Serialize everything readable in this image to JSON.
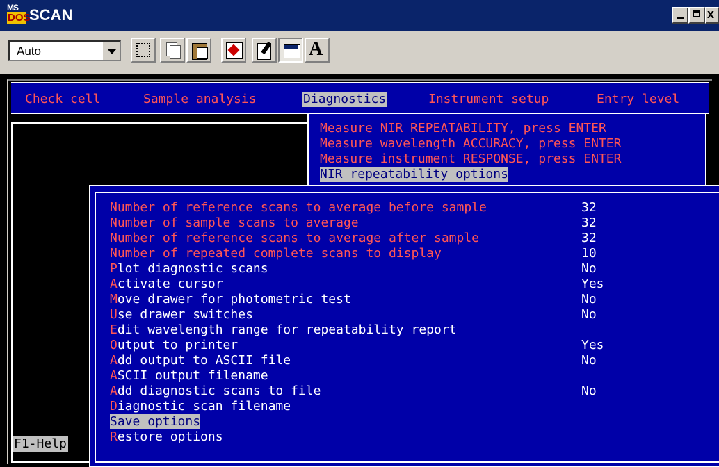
{
  "window": {
    "title": "SCAN",
    "app_icon": {
      "top": "MS",
      "bottom": "DOS"
    },
    "controls": {
      "minimize": "_",
      "maximize": "□",
      "close": "x"
    }
  },
  "toolbar": {
    "font_select_value": "Auto",
    "buttons": [
      "mark-icon",
      "copy-icon",
      "paste-icon",
      "fullscreen-icon",
      "properties-icon",
      "background-icon",
      "font-icon"
    ],
    "font_button_label": "A"
  },
  "menubar": {
    "items": [
      {
        "hot": "C",
        "rest": "heck cell"
      },
      {
        "hot": "S",
        "rest": "ample analysis"
      },
      {
        "hot": "D",
        "rest": "iagnostics"
      },
      {
        "hot": "I",
        "rest": "nstrument setup"
      },
      {
        "hot": "E",
        "rest": "ntry level"
      }
    ],
    "selected_index": 2
  },
  "dropdown": {
    "items": [
      {
        "hot": "M",
        "rest": "easure NIR REPEATABILITY, press ENTER"
      },
      {
        "hot": "M",
        "rest": "easure wavelength ACCURACY, press ENTER"
      },
      {
        "hot": "M",
        "rest": "easure instrument RESPONSE, press ENTER"
      },
      {
        "hot": "N",
        "rest": "IR repeatability options"
      }
    ],
    "selected_index": 3
  },
  "options": {
    "rows": [
      {
        "hot": "N",
        "rest": "umber of reference scans to average before sample",
        "value": "32"
      },
      {
        "hot": "N",
        "rest": "umber of sample scans to average",
        "value": "32"
      },
      {
        "hot": "N",
        "rest": "umber of reference scans to average after sample",
        "value": "32"
      },
      {
        "hot": "N",
        "rest": "umber of repeated complete scans to display",
        "value": "10"
      },
      {
        "hot": "P",
        "rest": "lot diagnostic scans",
        "value": "No"
      },
      {
        "hot": "A",
        "rest": "ctivate cursor",
        "value": "Yes"
      },
      {
        "hot": "M",
        "rest": "ove drawer for photometric test",
        "value": "No"
      },
      {
        "hot": "U",
        "rest": "se drawer switches",
        "value": "No"
      },
      {
        "hot": "E",
        "rest": "dit wavelength range for repeatability report",
        "value": ""
      },
      {
        "hot": "O",
        "rest": "utput to printer",
        "value": "Yes"
      },
      {
        "hot": "A",
        "rest": "dd output to ASCII file",
        "value": "No"
      },
      {
        "hot": "A",
        "rest": "SCII output filename",
        "value": ""
      },
      {
        "hot": "A",
        "rest": "dd diagnostic scans to file",
        "value": "No"
      },
      {
        "hot": "D",
        "rest": "iagnostic scan filename",
        "value": ""
      },
      {
        "hot": "S",
        "rest": "ave options",
        "value": ""
      },
      {
        "hot": "R",
        "rest": "estore options",
        "value": ""
      }
    ],
    "selected_index": 14
  },
  "status": {
    "help": "F1-Help"
  },
  "colors": {
    "menu_bg": "#0000a8",
    "hotkey": "#ff5555",
    "text": "#ffffff",
    "highlight_bg": "#c0c0c0",
    "highlight_fg": "#000080"
  }
}
